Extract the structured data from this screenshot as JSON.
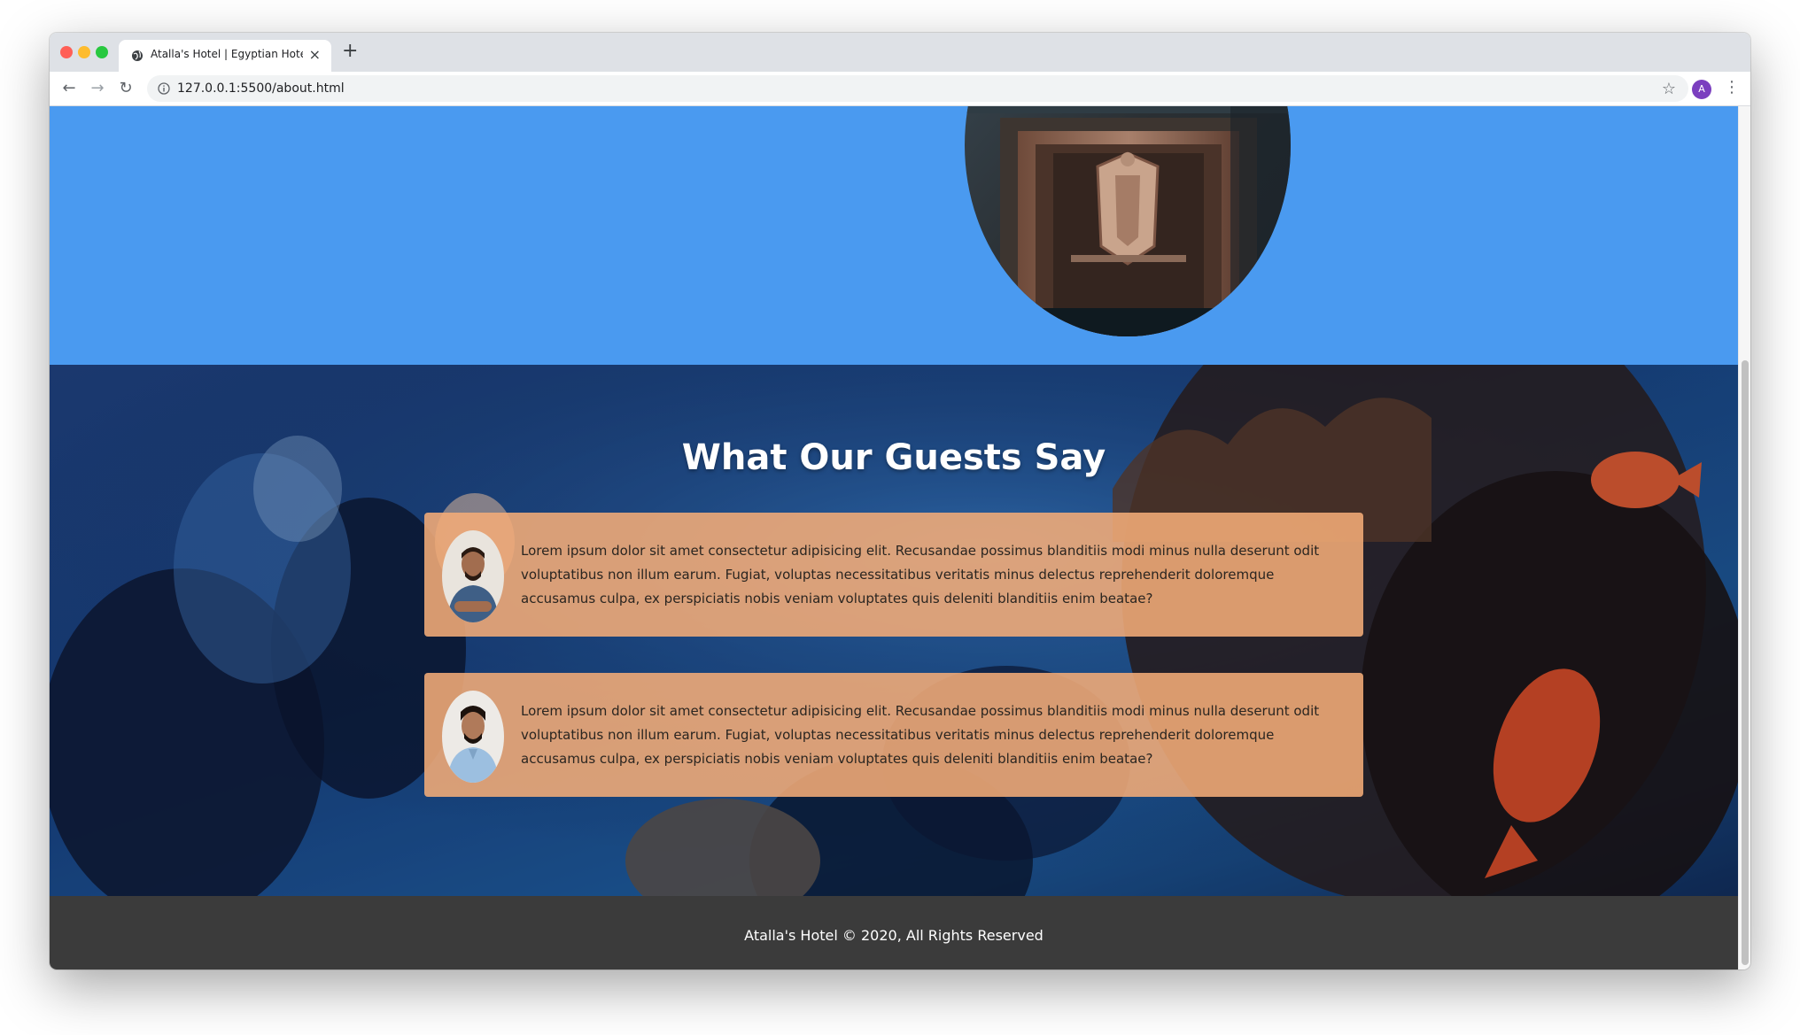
{
  "browser": {
    "tab_title": "Atalla's Hotel | Egyptian Hotel",
    "new_tab_label": "+",
    "close_label": "×",
    "url": "127.0.0.1:5500/about.html",
    "avatar_letter": "A",
    "back_glyph": "←",
    "forward_glyph": "→",
    "reload_glyph": "↻",
    "star_glyph": "☆",
    "menu_glyph": "⋮"
  },
  "icons": {
    "tab": "globe-icon",
    "omnibox": "info-icon",
    "star": "star-icon",
    "menu": "kebab-menu-icon"
  },
  "colors": {
    "hero_bg": "#4a9af0",
    "card_bg": "#f4ac78",
    "footer_bg": "#3b3b3b"
  },
  "guests": {
    "heading": "What Our Guests Say",
    "testimonials": [
      {
        "text": "Lorem ipsum dolor sit amet consectetur adipisicing elit. Recusandae possimus blanditiis modi minus nulla deserunt odit voluptatibus non illum earum. Fugiat, voluptas necessitatibus veritatis minus delectus reprehenderit doloremque accusamus culpa, ex perspiciatis nobis veniam voluptates quis deleniti blanditiis enim beatae?"
      },
      {
        "text": "Lorem ipsum dolor sit amet consectetur adipisicing elit. Recusandae possimus blanditiis modi minus nulla deserunt odit voluptatibus non illum earum. Fugiat, voluptas necessitatibus veritatis minus delectus reprehenderit doloremque accusamus culpa, ex perspiciatis nobis veniam voluptates quis deleniti blanditiis enim beatae?"
      }
    ]
  },
  "footer": {
    "text": "Atalla's Hotel © 2020, All Rights Reserved"
  }
}
